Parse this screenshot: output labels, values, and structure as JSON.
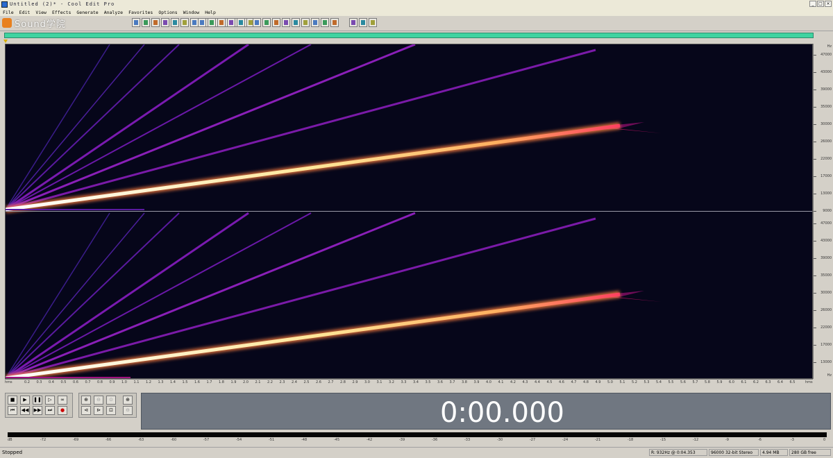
{
  "window": {
    "title": "Untitled (2)* - Cool Edit Pro"
  },
  "menu": [
    "File",
    "Edit",
    "View",
    "Effects",
    "Generate",
    "Analyze",
    "Favorites",
    "Options",
    "Window",
    "Help"
  ],
  "watermark": "Sound学院",
  "spectral": {
    "hz_label": "Hz",
    "freq_labels": [
      "47000",
      "43000",
      "39000",
      "35000",
      "30000",
      "26000",
      "22000",
      "17000",
      "13000",
      "9000",
      "5000"
    ]
  },
  "time_ruler": {
    "left_label": "hms",
    "right_label": "hms",
    "ticks": [
      "0.2",
      "0.3",
      "0.4",
      "0.5",
      "0.6",
      "0.7",
      "0.8",
      "0.9",
      "1.0",
      "1.1",
      "1.2",
      "1.3",
      "1.4",
      "1.5",
      "1.6",
      "1.7",
      "1.8",
      "1.9",
      "2.0",
      "2.1",
      "2.2",
      "2.3",
      "2.4",
      "2.5",
      "2.6",
      "2.7",
      "2.8",
      "2.9",
      "3.0",
      "3.1",
      "3.2",
      "3.3",
      "3.4",
      "3.5",
      "3.6",
      "3.7",
      "3.8",
      "3.9",
      "4.0",
      "4.1",
      "4.2",
      "4.3",
      "4.4",
      "4.5",
      "4.6",
      "4.7",
      "4.8",
      "4.9",
      "5.0",
      "5.1",
      "5.2",
      "5.3",
      "5.4",
      "5.5",
      "5.6",
      "5.7",
      "5.8",
      "5.9",
      "6.0",
      "6.1",
      "6.2",
      "6.3",
      "6.4",
      "6.5"
    ]
  },
  "display": {
    "time": "0:00.000"
  },
  "level_meter": {
    "db_labels": [
      "dB",
      "-72",
      "-69",
      "-66",
      "-63",
      "-60",
      "-57",
      "-54",
      "-51",
      "-48",
      "-45",
      "-42",
      "-39",
      "-36",
      "-33",
      "-30",
      "-27",
      "-24",
      "-21",
      "-18",
      "-15",
      "-12",
      "-9",
      "-6",
      "-3",
      "0"
    ]
  },
  "status": {
    "state": "Stopped",
    "cursor": "R: 932Hz @  0:04.353",
    "format": "96000 32-bit Stereo",
    "file_size": "4.94 MB",
    "free": "280 GB free"
  },
  "colors": {
    "progress": "#3fd3a0",
    "display_bg": "#707781",
    "spectrum_bg": "#06061a"
  }
}
